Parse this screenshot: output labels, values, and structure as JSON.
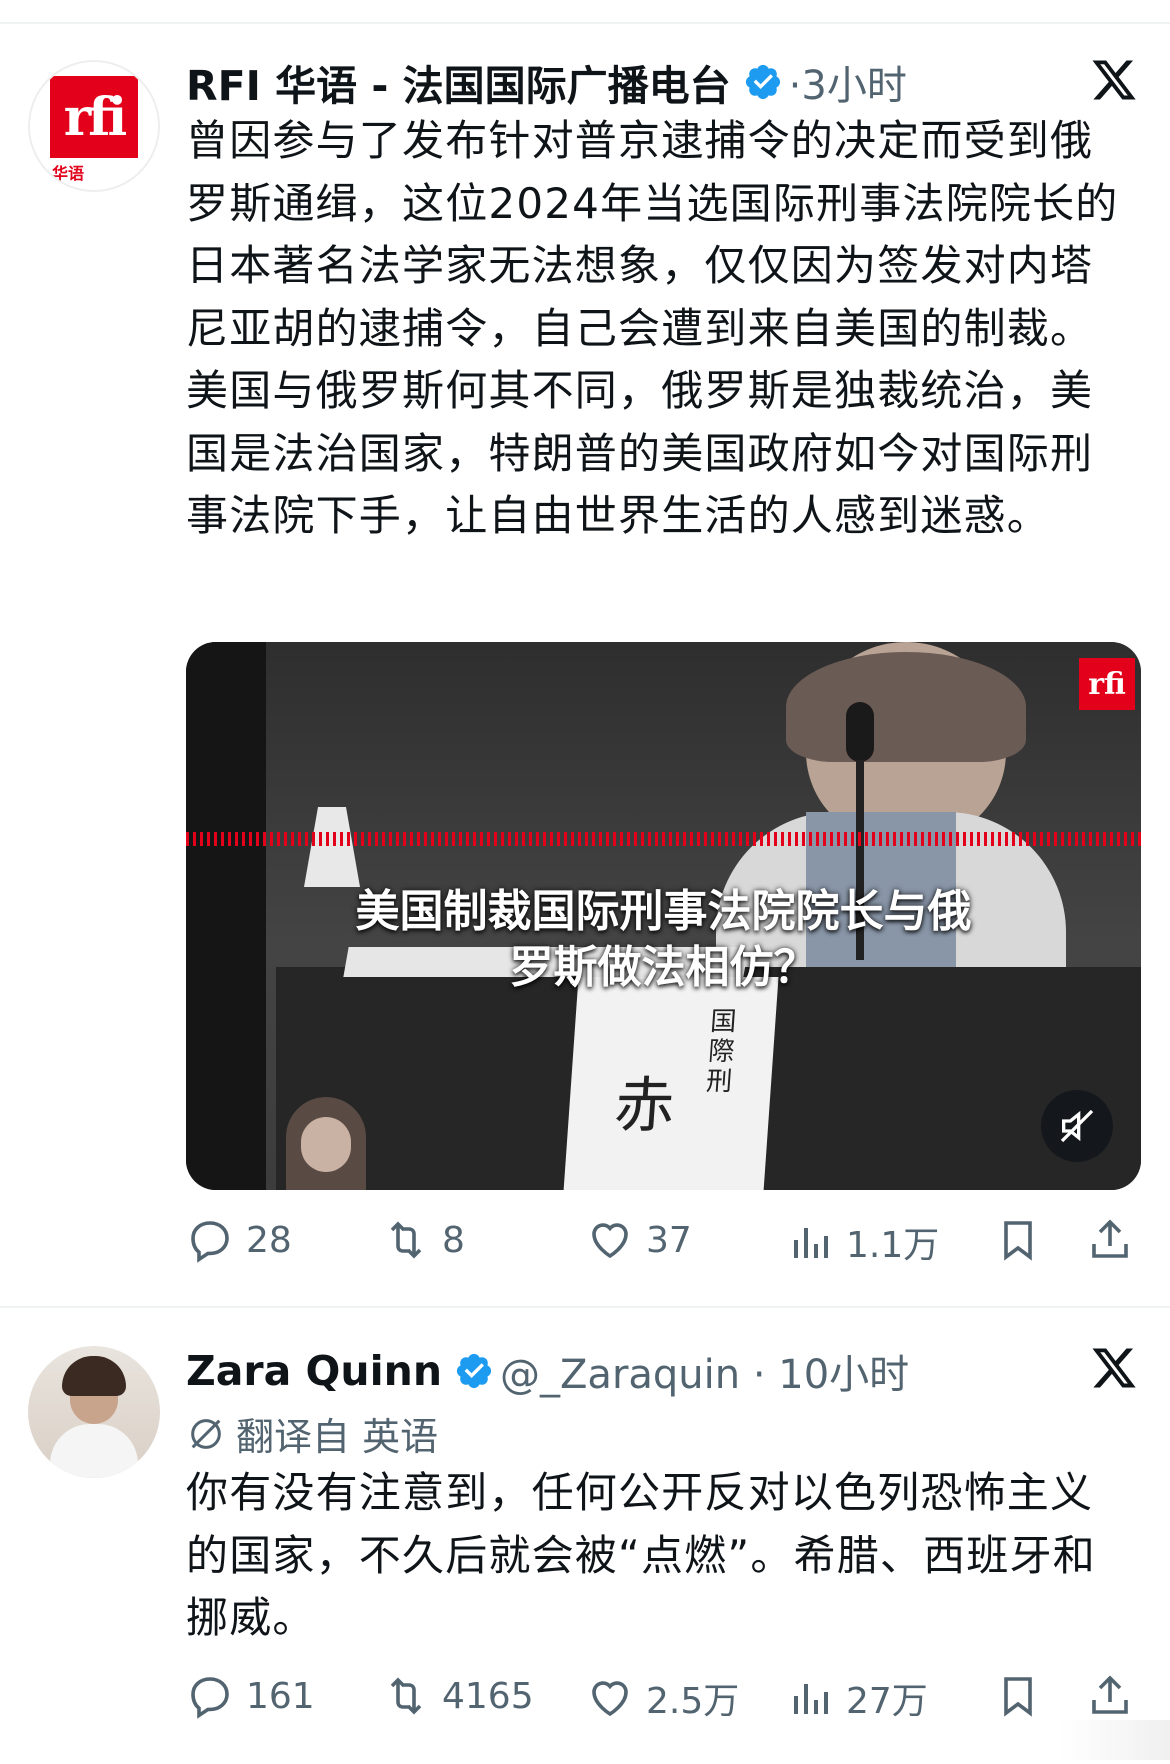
{
  "tweets": [
    {
      "author": "RFI 华语 - 法国国际广播电台",
      "meta": "·3小时",
      "avatar_text": "rfi",
      "avatar_sub": "华语",
      "text": "曾因参与了发布针对普京逮捕令的决定而受到俄罗斯通缉，这位2024年当选国际刑事法院院长的日本著名法学家无法想象，仅仅因为签发对内塔尼亚胡的逮捕令，自己会遭到来自美国的制裁。美国与俄罗斯何其不同，俄罗斯是独裁统治，美国是法治国家，特朗普的美国政府如今对国际刑事法院下手，让自由世界生活的人感到迷惑。",
      "media": {
        "caption_line1": "美国制裁国际刑事法院院长与俄",
        "caption_line2": "罗斯做法相仿？",
        "badge": "rfi",
        "nameplate": "赤",
        "nameplate_side": "国際刑"
      },
      "actions": {
        "replies": "28",
        "retweets": "8",
        "likes": "37",
        "views": "1.1万"
      }
    },
    {
      "author": "Zara Quinn",
      "meta": "@_Zaraquin · 10小时",
      "translated_label": "翻译自 英语",
      "text": "你有没有注意到，任何公开反对以色列恐怖主义的国家，不久后就会被“点燃”。希腊、西班牙和挪威。",
      "actions": {
        "replies": "161",
        "retweets": "4165",
        "likes": "2.5万",
        "views": "27万"
      }
    }
  ],
  "colors": {
    "verified": "#1d9bf0",
    "muted_text": "#536471",
    "rfi_red": "#e3001b"
  },
  "icons": [
    "verified-badge-icon",
    "x-logo-icon",
    "reply-icon",
    "retweet-icon",
    "like-icon",
    "views-icon",
    "bookmark-icon",
    "share-icon",
    "mute-icon",
    "translate-icon"
  ]
}
